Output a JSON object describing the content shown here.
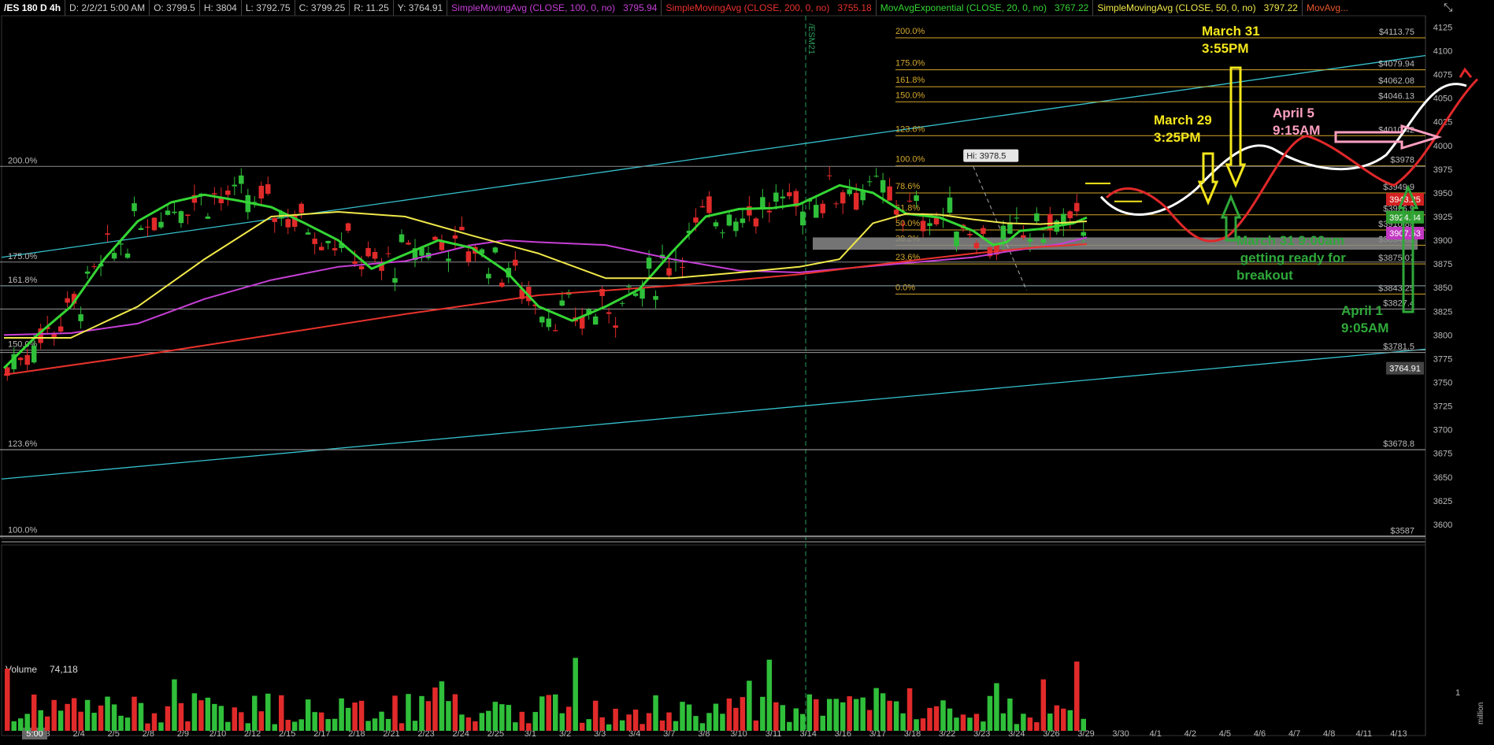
{
  "header": {
    "symbol": "/ES 180 D 4h",
    "date": "D: 2/2/21 5:00 AM",
    "open": "O: 3799.5",
    "high": "H: 3804",
    "low": "L: 3792.75",
    "close": "C: 3799.25",
    "range": "R: 11.25",
    "y": "Y: 3764.91",
    "studies": [
      {
        "label": "SimpleMovingAvg (CLOSE, 100, 0, no)",
        "value": "3795.94",
        "color": "#c63fd6"
      },
      {
        "label": "SimpleMovingAvg (CLOSE, 200, 0, no)",
        "value": "3755.18",
        "color": "#e8322c"
      },
      {
        "label": "MovAvgExponential (CLOSE, 20, 0, no)",
        "value": "3767.22",
        "color": "#34d634"
      },
      {
        "label": "SimpleMovingAvg (CLOSE, 50, 0, no)",
        "value": "3797.22",
        "color": "#f0e84a"
      },
      {
        "label": "MovAvg...",
        "value": "",
        "color": "#e8572c"
      }
    ]
  },
  "icons": {
    "corner": "collapse-arrows-icon"
  },
  "chart_data": {
    "type": "line",
    "title": "",
    "price_axis": {
      "ticks": [
        4125,
        4100,
        4075,
        4050,
        4025,
        4000,
        3975,
        3950,
        3925,
        3900,
        3875,
        3850,
        3825,
        3800,
        3775,
        3750,
        3725,
        3700,
        3675,
        3650,
        3625,
        3600
      ],
      "ylim": [
        3585,
        4137
      ]
    },
    "x_ticks": [
      "2/3",
      "2/4",
      "2/5",
      "2/8",
      "2/9",
      "2/10",
      "2/12",
      "2/15",
      "2/17",
      "2/18",
      "2/21",
      "2/23",
      "2/24",
      "2/25",
      "3/1",
      "3/2",
      "3/3",
      "3/4",
      "3/7",
      "3/8",
      "3/10",
      "3/11",
      "3/14",
      "3/16",
      "3/17",
      "3/18",
      "3/22",
      "3/23",
      "3/24",
      "3/26",
      "3/29",
      "3/30",
      "4/1",
      "4/2",
      "4/5",
      "4/6",
      "4/7",
      "4/8",
      "4/11",
      "4/13"
    ],
    "x_first_label": "5:00",
    "contract_roll_label": "/ESM21",
    "price_levels": [
      {
        "label": "$4113.75",
        "pct": "200.0%",
        "value": 4113.75,
        "color": "#d4a82a"
      },
      {
        "label": "$4079.94",
        "pct": "175.0%",
        "value": 4079.94,
        "color": "#d4a82a"
      },
      {
        "label": "$4062.08",
        "pct": "161.8%",
        "value": 4062.08,
        "color": "#d4a82a"
      },
      {
        "label": "$4046.13",
        "pct": "150.0%",
        "value": 4046.13,
        "color": "#d4a82a"
      },
      {
        "label": "$4010.42",
        "pct": "123.6%",
        "value": 4010.42,
        "color": "#d4a82a"
      },
      {
        "label": "$3978",
        "pct": "100.0%",
        "value": 3978.5,
        "color": "#d4a82a"
      },
      {
        "label": "$3949.9",
        "pct": "78.6%",
        "value": 3949.9,
        "color": "#d4a82a"
      },
      {
        "label": "$3926.9",
        "pct": "61.8%",
        "value": 3926.9,
        "color": "#d4a82a"
      },
      {
        "label": "$3910.88",
        "pct": "50.0%",
        "value": 3910.88,
        "color": "#d4a82a"
      },
      {
        "label": "$3894.82",
        "pct": "38.2%",
        "value": 3894.82,
        "color": "#d4a82a"
      },
      {
        "label": "$3875.07",
        "pct": "23.6%",
        "value": 3875.07,
        "color": "#d4a82a"
      },
      {
        "label": "$3843.25",
        "pct": "0.0%",
        "value": 3843.25,
        "color": "#d4a82a"
      },
      {
        "label": "$3827.4",
        "value": 3827.4,
        "color": "#9a9a9a"
      },
      {
        "label": "$3781.5",
        "value": 3781.5,
        "color": "#9a9a9a"
      },
      {
        "label": "$3678.8",
        "value": 3678.8,
        "color": "#9a9a9a"
      },
      {
        "label": "$3587",
        "value": 3587,
        "color": "#9a9a9a"
      }
    ],
    "left_fib_labels": [
      {
        "pct": "200.0%",
        "value": 3978
      },
      {
        "pct": "175.0%",
        "value": 3877
      },
      {
        "pct": "161.8%",
        "value": 3852
      },
      {
        "pct": "150.0%",
        "value": 3784
      },
      {
        "pct": "123.6%",
        "value": 3679
      },
      {
        "pct": "100.0%",
        "value": 3588
      }
    ],
    "hi_label": "Hi: 3978.5",
    "current_badges": [
      {
        "value": "3943.25",
        "bg": "#d32121",
        "fg": "#ffffff"
      },
      {
        "value": "3924.34",
        "bg": "#2f9e2f",
        "fg": "#ffffff"
      },
      {
        "value": "3907.53",
        "bg": "#c238c2",
        "fg": "#ffffff"
      },
      {
        "value": "3764.91",
        "bg": "#444444",
        "fg": "#ffffff"
      }
    ],
    "annotations": [
      {
        "text": "March 31\n3:55PM",
        "color": "#f4e61c"
      },
      {
        "text": "March 29\n3:25PM",
        "color": "#f4e61c"
      },
      {
        "text": "April 5\n9:15AM",
        "color": "#ff9fc0"
      },
      {
        "text": "March 31  9:00am\n getting ready for\nbreakout",
        "color": "#2fa83a"
      },
      {
        "text": "April 1\n9:05AM",
        "color": "#2fa83a"
      }
    ],
    "volume": {
      "label": "Volume",
      "value": "74,118",
      "ticks": [
        "1"
      ],
      "unit": "million"
    },
    "series": [
      {
        "name": "SimpleMovingAvg (CLOSE, 100, 0, no)",
        "color": "#c63fd6",
        "x": [
          0,
          10,
          20,
          30,
          40,
          50,
          60,
          66,
          70,
          75,
          80,
          90,
          100,
          110,
          119,
          135,
          145,
          150,
          155,
          158,
          162
        ],
        "values": [
          3800,
          3802,
          3812,
          3838,
          3858,
          3872,
          3878,
          3888,
          3895,
          3900,
          3898,
          3895,
          3880,
          3868,
          3866,
          3876,
          3882,
          3888,
          3893,
          3896,
          3903
        ]
      },
      {
        "name": "SimpleMovingAvg (CLOSE, 200, 0, no)",
        "color": "#e8322c",
        "x": [
          0,
          20,
          40,
          60,
          80,
          100,
          119,
          135,
          145,
          155,
          160,
          162
        ],
        "values": [
          3758,
          3778,
          3800,
          3822,
          3842,
          3852,
          3864,
          3878,
          3886,
          3893,
          3895,
          3896
        ]
      },
      {
        "name": "MovAvgExponential (CLOSE, 20, 0, no)",
        "color": "#34d634",
        "x": [
          0,
          5,
          10,
          15,
          20,
          25,
          30,
          35,
          40,
          45,
          50,
          55,
          60,
          65,
          70,
          75,
          80,
          85,
          90,
          95,
          100,
          105,
          110,
          115,
          119,
          125,
          130,
          135,
          140,
          145,
          148,
          150,
          152,
          155,
          160,
          162
        ],
        "values": [
          3765,
          3800,
          3830,
          3880,
          3920,
          3940,
          3948,
          3942,
          3935,
          3918,
          3900,
          3870,
          3885,
          3900,
          3892,
          3868,
          3830,
          3815,
          3830,
          3848,
          3888,
          3925,
          3933,
          3934,
          3938,
          3958,
          3950,
          3928,
          3924,
          3910,
          3895,
          3898,
          3910,
          3912,
          3918,
          3924
        ]
      },
      {
        "name": "SimpleMovingAvg (CLOSE, 50, 0, no)",
        "color": "#f0e84a",
        "x": [
          0,
          10,
          20,
          30,
          40,
          50,
          60,
          70,
          80,
          90,
          100,
          110,
          119,
          125,
          130,
          135,
          140,
          145,
          150,
          155,
          162
        ],
        "values": [
          3797,
          3797,
          3830,
          3880,
          3925,
          3930,
          3925,
          3905,
          3886,
          3860,
          3860,
          3866,
          3872,
          3880,
          3918,
          3928,
          3927,
          3922,
          3918,
          3917,
          3920
        ]
      }
    ]
  }
}
